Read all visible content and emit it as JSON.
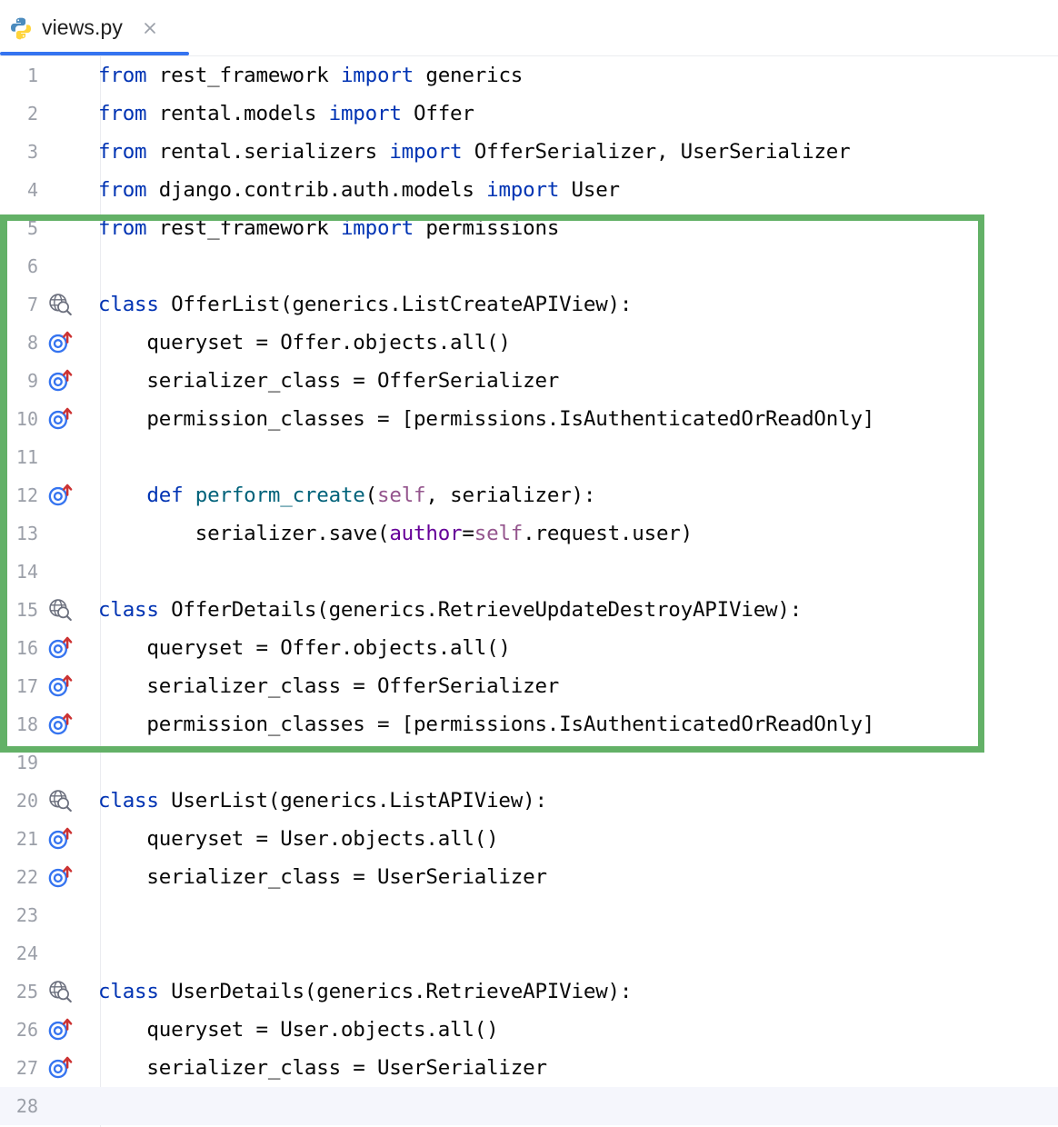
{
  "tab": {
    "label": "views.py",
    "icon": "python-file-icon",
    "close_icon": "close-icon",
    "active": true,
    "underline_color": "#3574F0"
  },
  "editor": {
    "language": "Python",
    "caret_line": 28,
    "gutter_icon_names": {
      "globe-search": "endpoint-globe-search-icon",
      "overridden": "overridden-member-icon"
    },
    "colors": {
      "keyword": "#0033B3",
      "function": "#00627A",
      "self": "#94558D",
      "keyword_argument": "#660099",
      "text": "#080808",
      "line_number": "#9B9FA8",
      "caret_line_bg": "#F5F6FC",
      "gutter_globe": "#6C707E",
      "gutter_overridden": "#3574F0",
      "gutter_arrow": "#CC3333"
    },
    "lines": [
      {
        "n": "1",
        "gutter": null,
        "tokens": [
          {
            "t": "from",
            "c": "kw"
          },
          {
            "t": " rest_framework ",
            "c": ""
          },
          {
            "t": "import",
            "c": "kw"
          },
          {
            "t": " generics",
            "c": ""
          }
        ]
      },
      {
        "n": "2",
        "gutter": null,
        "tokens": [
          {
            "t": "from",
            "c": "kw"
          },
          {
            "t": " rental.models ",
            "c": ""
          },
          {
            "t": "import",
            "c": "kw"
          },
          {
            "t": " Offer",
            "c": ""
          }
        ]
      },
      {
        "n": "3",
        "gutter": null,
        "tokens": [
          {
            "t": "from",
            "c": "kw"
          },
          {
            "t": " rental.serializers ",
            "c": ""
          },
          {
            "t": "import",
            "c": "kw"
          },
          {
            "t": " OfferSerializer, UserSerializer",
            "c": ""
          }
        ]
      },
      {
        "n": "4",
        "gutter": null,
        "tokens": [
          {
            "t": "from",
            "c": "kw"
          },
          {
            "t": " django.contrib.auth.models ",
            "c": ""
          },
          {
            "t": "import",
            "c": "kw"
          },
          {
            "t": " User",
            "c": ""
          }
        ]
      },
      {
        "n": "5",
        "gutter": null,
        "tokens": [
          {
            "t": "from",
            "c": "kw"
          },
          {
            "t": " rest_framework ",
            "c": ""
          },
          {
            "t": "import",
            "c": "kw"
          },
          {
            "t": " permissions",
            "c": ""
          }
        ]
      },
      {
        "n": "6",
        "gutter": null,
        "tokens": []
      },
      {
        "n": "7",
        "gutter": "globe",
        "tokens": [
          {
            "t": "class",
            "c": "kw"
          },
          {
            "t": " OfferList(generics.ListCreateAPIView):",
            "c": ""
          }
        ]
      },
      {
        "n": "8",
        "gutter": "overridden",
        "tokens": [
          {
            "t": "    queryset = Offer.objects.all()",
            "c": ""
          }
        ]
      },
      {
        "n": "9",
        "gutter": "overridden",
        "tokens": [
          {
            "t": "    serializer_class = OfferSerializer",
            "c": ""
          }
        ]
      },
      {
        "n": "10",
        "gutter": "overridden",
        "tokens": [
          {
            "t": "    permission_classes = [permissions.IsAuthenticatedOrReadOnly]",
            "c": ""
          }
        ]
      },
      {
        "n": "11",
        "gutter": null,
        "tokens": []
      },
      {
        "n": "12",
        "gutter": "overridden",
        "tokens": [
          {
            "t": "    ",
            "c": ""
          },
          {
            "t": "def",
            "c": "kw"
          },
          {
            "t": " ",
            "c": ""
          },
          {
            "t": "perform_create",
            "c": "fn"
          },
          {
            "t": "(",
            "c": ""
          },
          {
            "t": "self",
            "c": "slf"
          },
          {
            "t": ", serializer):",
            "c": ""
          }
        ]
      },
      {
        "n": "13",
        "gutter": null,
        "tokens": [
          {
            "t": "        serializer.save(",
            "c": ""
          },
          {
            "t": "author",
            "c": "kwarg"
          },
          {
            "t": "=",
            "c": ""
          },
          {
            "t": "self",
            "c": "slf"
          },
          {
            "t": ".request.user)",
            "c": ""
          }
        ]
      },
      {
        "n": "14",
        "gutter": null,
        "tokens": []
      },
      {
        "n": "15",
        "gutter": "globe",
        "tokens": [
          {
            "t": "class",
            "c": "kw"
          },
          {
            "t": " OfferDetails(generics.RetrieveUpdateDestroyAPIView):",
            "c": ""
          }
        ]
      },
      {
        "n": "16",
        "gutter": "overridden",
        "tokens": [
          {
            "t": "    queryset = Offer.objects.all()",
            "c": ""
          }
        ]
      },
      {
        "n": "17",
        "gutter": "overridden",
        "tokens": [
          {
            "t": "    serializer_class = OfferSerializer",
            "c": ""
          }
        ]
      },
      {
        "n": "18",
        "gutter": "overridden",
        "tokens": [
          {
            "t": "    permission_classes = [permissions.IsAuthenticatedOrReadOnly]",
            "c": ""
          }
        ]
      },
      {
        "n": "19",
        "gutter": null,
        "tokens": []
      },
      {
        "n": "20",
        "gutter": "globe",
        "tokens": [
          {
            "t": "class",
            "c": "kw"
          },
          {
            "t": " UserList(generics.ListAPIView):",
            "c": ""
          }
        ]
      },
      {
        "n": "21",
        "gutter": "overridden",
        "tokens": [
          {
            "t": "    queryset = User.objects.all()",
            "c": ""
          }
        ]
      },
      {
        "n": "22",
        "gutter": "overridden",
        "tokens": [
          {
            "t": "    serializer_class = UserSerializer",
            "c": ""
          }
        ]
      },
      {
        "n": "23",
        "gutter": null,
        "tokens": []
      },
      {
        "n": "24",
        "gutter": null,
        "tokens": []
      },
      {
        "n": "25",
        "gutter": "globe",
        "tokens": [
          {
            "t": "class",
            "c": "kw"
          },
          {
            "t": " UserDetails(generics.RetrieveAPIView):",
            "c": ""
          }
        ]
      },
      {
        "n": "26",
        "gutter": "overridden",
        "tokens": [
          {
            "t": "    queryset = User.objects.all()",
            "c": ""
          }
        ]
      },
      {
        "n": "27",
        "gutter": "overridden",
        "tokens": [
          {
            "t": "    serializer_class = UserSerializer",
            "c": ""
          }
        ]
      },
      {
        "n": "28",
        "gutter": null,
        "tokens": [],
        "caret": true
      }
    ]
  },
  "annotation": {
    "type": "highlight-rectangle",
    "color": "#63B167",
    "covers_lines": "5-18"
  }
}
